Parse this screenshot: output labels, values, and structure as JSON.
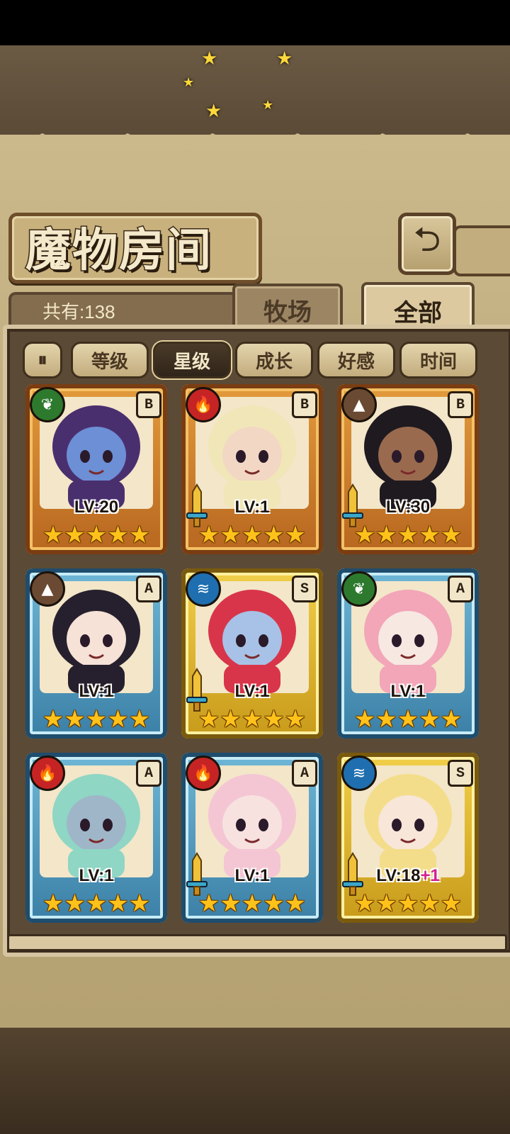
{
  "screen": {
    "title": "魔物房间",
    "back_icon": "return-icon",
    "count_label": "共有:138"
  },
  "tabs": [
    {
      "label": "牧场",
      "active": false
    },
    {
      "label": "全部",
      "active": true
    }
  ],
  "sort": {
    "toggle_icon": "sort-order-icon",
    "toggle_glyph": "⏸",
    "options": [
      {
        "label": "等级",
        "active": false
      },
      {
        "label": "星级",
        "active": true
      },
      {
        "label": "成长",
        "active": false
      },
      {
        "label": "好感",
        "active": false
      },
      {
        "label": "时间",
        "active": false
      }
    ]
  },
  "monsters": [
    {
      "level": "LV:20",
      "level_bonus": "",
      "rank": "B",
      "element": "leaf",
      "element_glyph": "❦",
      "frame": "bronze",
      "stars": 5,
      "weapon": false,
      "skin": "#6c8fd6",
      "hair": "#4a2f6e"
    },
    {
      "level": "LV:1",
      "level_bonus": "",
      "rank": "B",
      "element": "fire",
      "element_glyph": "🔥",
      "frame": "bronze",
      "stars": 5,
      "weapon": true,
      "skin": "#f2d7c4",
      "hair": "#f1e6b8"
    },
    {
      "level": "LV:30",
      "level_bonus": "",
      "rank": "B",
      "element": "earth",
      "element_glyph": "▲",
      "frame": "bronze",
      "stars": 5,
      "weapon": true,
      "skin": "#9a6a4e",
      "hair": "#1f1a20"
    },
    {
      "level": "LV:1",
      "level_bonus": "",
      "rank": "A",
      "element": "earth",
      "element_glyph": "▲",
      "frame": "blue",
      "stars": 5,
      "weapon": false,
      "skin": "#f6e2d6",
      "hair": "#26202e"
    },
    {
      "level": "LV:1",
      "level_bonus": "",
      "rank": "S",
      "element": "water",
      "element_glyph": "≋",
      "frame": "gold",
      "stars": 5,
      "weapon": true,
      "skin": "#a7c2e6",
      "hair": "#d8354a"
    },
    {
      "level": "LV:1",
      "level_bonus": "",
      "rank": "A",
      "element": "leaf",
      "element_glyph": "❦",
      "frame": "blue",
      "stars": 5,
      "weapon": false,
      "skin": "#f7e8e2",
      "hair": "#f2a6b8"
    },
    {
      "level": "LV:1",
      "level_bonus": "",
      "rank": "A",
      "element": "fire",
      "element_glyph": "🔥",
      "frame": "blue",
      "stars": 5,
      "weapon": false,
      "skin": "#9fb6c8",
      "hair": "#8fd6c4"
    },
    {
      "level": "LV:1",
      "level_bonus": "",
      "rank": "A",
      "element": "fire",
      "element_glyph": "🔥",
      "frame": "blue",
      "stars": 5,
      "weapon": true,
      "skin": "#f7e2e0",
      "hair": "#f4c6d4"
    },
    {
      "level": "LV:18",
      "level_bonus": "+1",
      "rank": "S",
      "element": "water",
      "element_glyph": "≋",
      "frame": "gold",
      "stars": 5,
      "weapon": true,
      "skin": "#f8e6d8",
      "hair": "#f4dd8a"
    }
  ]
}
